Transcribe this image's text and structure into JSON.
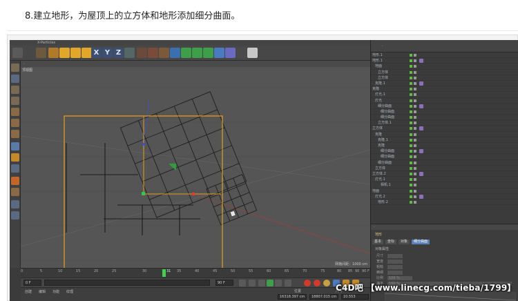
{
  "caption": "8.建立地形，为屋顶上的立方体和地形添加细分曲面。",
  "toolbar": {
    "axis_buttons": [
      "X",
      "Y",
      "Z"
    ],
    "menu_item": "X-Particles"
  },
  "viewport": {
    "title": "顶视图",
    "grid_spacing": "网格间距：1000 cm"
  },
  "timeline": {
    "ticks": [
      "0",
      "5",
      "10",
      "15",
      "20",
      "25",
      "30",
      "35",
      "40",
      "45",
      "50",
      "55",
      "60",
      "65",
      "70",
      "75",
      "80",
      "85",
      "90"
    ],
    "playhead_label": "31",
    "end_label": "90 F",
    "current_frame": "0 F",
    "end_frame": "90 F"
  },
  "bottom": {
    "menu": [
      "创建",
      "编辑",
      "功能",
      "纹理"
    ],
    "coord_label": "位置",
    "size_label": "尺寸",
    "coord_x": "16318.397 cm",
    "coord_y": "18807.015 cm",
    "coord_z": "10.553"
  },
  "object_manager": {
    "rows": [
      "地形.1",
      "地形.1",
      "地面",
      "立方体",
      "立方体",
      "克隆.1",
      "克隆",
      "灯光.1",
      "灯光",
      "细分曲面",
      "细分曲面",
      "细分曲面",
      "立方体.1",
      "立方体",
      "克隆",
      "克隆.1",
      "克隆",
      "细分曲面",
      "细分曲面",
      "细分曲面",
      "立方体",
      "立方体.2",
      "灯光.1",
      "相机.1",
      "地面",
      "灯光.2",
      "地形.2"
    ]
  },
  "attribute_manager": {
    "object_name": "地形",
    "tabs": [
      "基本",
      "坐标",
      "对象",
      "细分曲面"
    ],
    "section": "对象属性",
    "fields": [
      {
        "key": "尺寸",
        "value": ""
      },
      {
        "key": "宽度",
        "value": ""
      },
      {
        "key": "粗糙",
        "value": ""
      },
      {
        "key": "精细",
        "value": ""
      },
      {
        "key": "比例",
        "value": "100 %"
      },
      {
        "key": "海平",
        "value": "100 %"
      },
      {
        "key": "地平",
        "value": "10 %"
      }
    ]
  },
  "watermark": "C4D吧 【www.linecg.com/tieba/1799】",
  "colors": {
    "app_bg": "#3b3b3b",
    "viewport_bg": "#555555",
    "selection": "#e8a01c",
    "axis_red": "#e23c2a",
    "axis_green": "#34c84a",
    "axis_blue": "#3a53d8"
  }
}
